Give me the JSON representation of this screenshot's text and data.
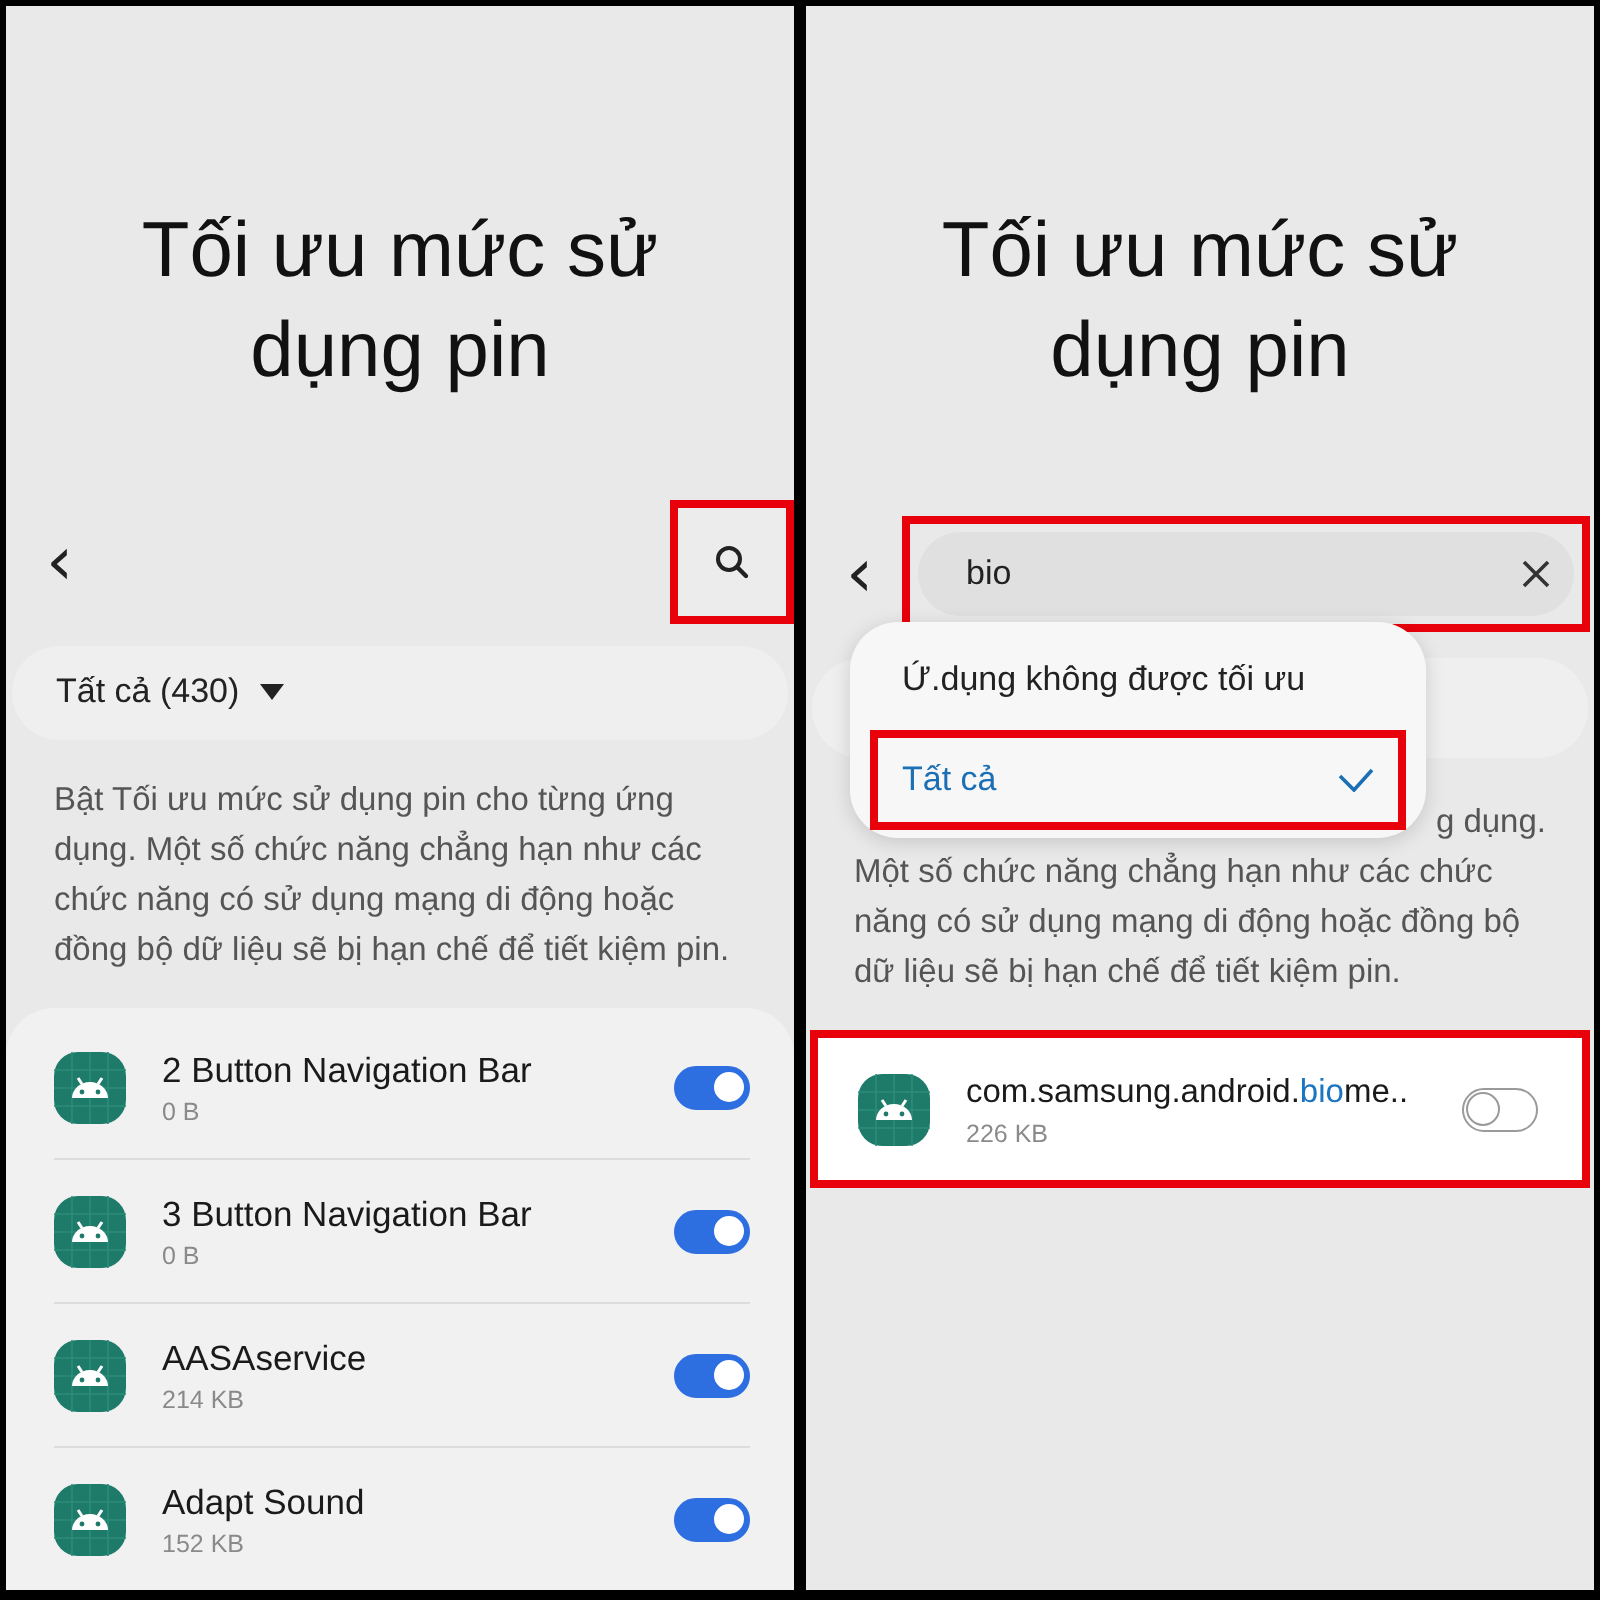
{
  "left_screen": {
    "title": "Tối ưu mức sử dụng pin",
    "toolbar": {
      "back": "‹",
      "search_highlighted": true
    },
    "filter": {
      "label": "Tất cả (430)"
    },
    "description": "Bật Tối ưu mức sử dụng pin cho từng ứng dụng. Một số chức năng chẳng hạn như các chức năng có sử dụng mạng di động hoặc đồng bộ dữ liệu sẽ bị hạn chế để tiết kiệm pin.",
    "apps": [
      {
        "name": "2 Button Navigation Bar",
        "size": "0 B",
        "on": true
      },
      {
        "name": "3 Button Navigation Bar",
        "size": "0 B",
        "on": true
      },
      {
        "name": "AASAservice",
        "size": "214 KB",
        "on": true
      },
      {
        "name": "Adapt Sound",
        "size": "152 KB",
        "on": true
      }
    ]
  },
  "right_screen": {
    "title": "Tối ưu mức sử dụng pin",
    "back": "‹",
    "search": {
      "value": "bio",
      "highlighted": true
    },
    "filter_menu": [
      {
        "label": "Ứ.dụng không được tối ưu",
        "selected": false,
        "highlighted": false
      },
      {
        "label": "Tất cả",
        "selected": true,
        "highlighted": true
      }
    ],
    "description_lines": [
      "g dụng.",
      "Một số chức năng chẳng hạn như các chức",
      "năng có sử dụng mạng di động hoặc đồng bộ",
      "dữ liệu sẽ bị hạn chế để tiết kiệm pin."
    ],
    "results": [
      {
        "name_before": "com.samsung.android.",
        "name_match": "bio",
        "name_after": "me..",
        "size": "226 KB",
        "on": false,
        "highlighted": true
      }
    ]
  }
}
